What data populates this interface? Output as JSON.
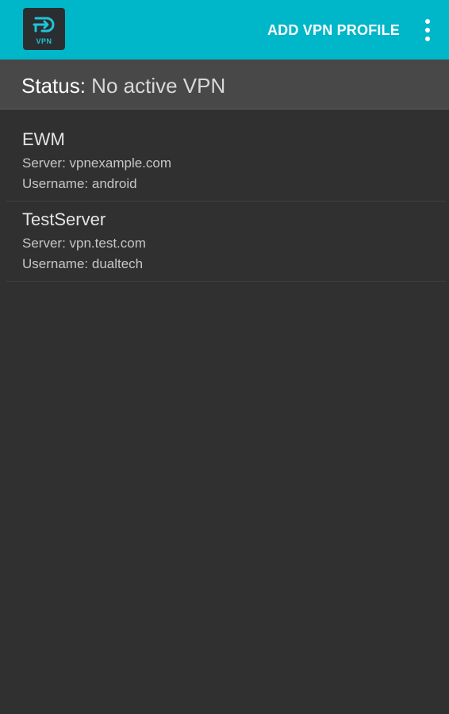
{
  "toolbar": {
    "app_icon": "vpn-app-icon",
    "app_icon_label": "VPN",
    "add_button_label": "ADD VPN PROFILE",
    "overflow_icon": "more-vert-icon",
    "color": "#00b6c9"
  },
  "status": {
    "label": "Status:",
    "value": "No active VPN"
  },
  "profiles": [
    {
      "name": "EWM",
      "server": "Server: vpnexample.com",
      "username": "Username: android"
    },
    {
      "name": "TestServer",
      "server": "Server: vpn.test.com",
      "username": "Username: dualtech"
    }
  ]
}
